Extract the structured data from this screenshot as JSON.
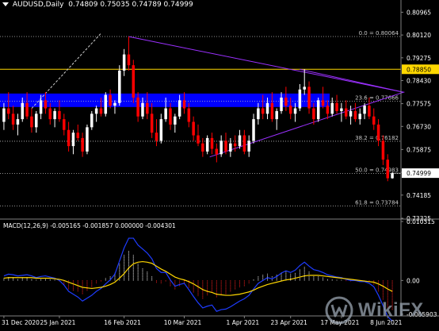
{
  "header": {
    "symbol_tf": "AUDUSD,Daily",
    "ohlc": "0.74809 0.75035 0.74789 0.74999"
  },
  "colors": {
    "background": "#000000",
    "bull": "#ffffff",
    "bear": "#ff0000",
    "fib_line": "#c0c0c0",
    "blue_zone": "#0000ff",
    "triangle": "#9b30ff",
    "resistance": "#ffd700",
    "macd_line": "#1e3cff",
    "signal_line": "#ffd700"
  },
  "chart_data": [
    {
      "type": "candlestick",
      "price_axis": [
        "0.80965",
        "0.80120",
        "0.79275",
        "0.78430",
        "0.77575",
        "0.76730",
        "0.75875",
        "0.75030",
        "0.74185",
        "0.73325"
      ],
      "ylim": [
        0.73325,
        0.81065
      ],
      "date_axis": [
        "31 Dec 2020",
        "25 Jan 2021",
        "16 Feb 2021",
        "10 Mar 2021",
        "1 Apr 2021",
        "23 Apr 2021",
        "17 May 2021",
        "8 Jun 2021"
      ],
      "fib_levels": [
        {
          "label": "0.0 = 0.80064",
          "value": 0.80064
        },
        {
          "label": "23.6 = 0.77666",
          "value": 0.77666
        },
        {
          "label": "38.2 = 0.76182",
          "value": 0.76182
        },
        {
          "label": "50.0 = 0.74983",
          "value": 0.74983
        },
        {
          "label": "61.8 = 0.73784",
          "value": 0.73784
        }
      ],
      "resistance": {
        "value": 0.7885,
        "label": "0.78850"
      },
      "last_price": {
        "value": 0.74999,
        "label": "0.74999"
      },
      "blue_zone": [
        0.7745,
        0.7795
      ],
      "candles": [
        {
          "o": 0.769,
          "h": 0.776,
          "l": 0.766,
          "c": 0.774
        },
        {
          "o": 0.774,
          "h": 0.78,
          "l": 0.77,
          "c": 0.772
        },
        {
          "o": 0.772,
          "h": 0.775,
          "l": 0.766,
          "c": 0.768
        },
        {
          "o": 0.768,
          "h": 0.772,
          "l": 0.764,
          "c": 0.77
        },
        {
          "o": 0.77,
          "h": 0.778,
          "l": 0.769,
          "c": 0.776
        },
        {
          "o": 0.776,
          "h": 0.78,
          "l": 0.77,
          "c": 0.771
        },
        {
          "o": 0.771,
          "h": 0.774,
          "l": 0.765,
          "c": 0.767
        },
        {
          "o": 0.767,
          "h": 0.773,
          "l": 0.765,
          "c": 0.772
        },
        {
          "o": 0.772,
          "h": 0.779,
          "l": 0.77,
          "c": 0.777
        },
        {
          "o": 0.777,
          "h": 0.78,
          "l": 0.772,
          "c": 0.774
        },
        {
          "o": 0.774,
          "h": 0.776,
          "l": 0.768,
          "c": 0.77
        },
        {
          "o": 0.77,
          "h": 0.774,
          "l": 0.767,
          "c": 0.773
        },
        {
          "o": 0.773,
          "h": 0.777,
          "l": 0.769,
          "c": 0.77
        },
        {
          "o": 0.77,
          "h": 0.772,
          "l": 0.764,
          "c": 0.766
        },
        {
          "o": 0.766,
          "h": 0.769,
          "l": 0.758,
          "c": 0.76
        },
        {
          "o": 0.76,
          "h": 0.766,
          "l": 0.757,
          "c": 0.765
        },
        {
          "o": 0.765,
          "h": 0.768,
          "l": 0.762,
          "c": 0.763
        },
        {
          "o": 0.763,
          "h": 0.765,
          "l": 0.756,
          "c": 0.758
        },
        {
          "o": 0.758,
          "h": 0.768,
          "l": 0.757,
          "c": 0.767
        },
        {
          "o": 0.767,
          "h": 0.773,
          "l": 0.766,
          "c": 0.772
        },
        {
          "o": 0.772,
          "h": 0.775,
          "l": 0.769,
          "c": 0.774
        },
        {
          "o": 0.774,
          "h": 0.778,
          "l": 0.771,
          "c": 0.772
        },
        {
          "o": 0.772,
          "h": 0.78,
          "l": 0.771,
          "c": 0.779
        },
        {
          "o": 0.779,
          "h": 0.781,
          "l": 0.774,
          "c": 0.775
        },
        {
          "o": 0.775,
          "h": 0.777,
          "l": 0.772,
          "c": 0.776
        },
        {
          "o": 0.776,
          "h": 0.79,
          "l": 0.775,
          "c": 0.788
        },
        {
          "o": 0.788,
          "h": 0.796,
          "l": 0.786,
          "c": 0.794
        },
        {
          "o": 0.794,
          "h": 0.8006,
          "l": 0.788,
          "c": 0.79
        },
        {
          "o": 0.79,
          "h": 0.792,
          "l": 0.776,
          "c": 0.778
        },
        {
          "o": 0.778,
          "h": 0.78,
          "l": 0.769,
          "c": 0.771
        },
        {
          "o": 0.771,
          "h": 0.778,
          "l": 0.77,
          "c": 0.776
        },
        {
          "o": 0.776,
          "h": 0.78,
          "l": 0.77,
          "c": 0.772
        },
        {
          "o": 0.772,
          "h": 0.776,
          "l": 0.763,
          "c": 0.765
        },
        {
          "o": 0.765,
          "h": 0.77,
          "l": 0.76,
          "c": 0.762
        },
        {
          "o": 0.762,
          "h": 0.772,
          "l": 0.761,
          "c": 0.77
        },
        {
          "o": 0.77,
          "h": 0.778,
          "l": 0.769,
          "c": 0.774
        },
        {
          "o": 0.774,
          "h": 0.776,
          "l": 0.766,
          "c": 0.768
        },
        {
          "o": 0.768,
          "h": 0.772,
          "l": 0.765,
          "c": 0.771
        },
        {
          "o": 0.771,
          "h": 0.779,
          "l": 0.77,
          "c": 0.777
        },
        {
          "o": 0.777,
          "h": 0.78,
          "l": 0.772,
          "c": 0.774
        },
        {
          "o": 0.774,
          "h": 0.776,
          "l": 0.767,
          "c": 0.769
        },
        {
          "o": 0.769,
          "h": 0.771,
          "l": 0.762,
          "c": 0.764
        },
        {
          "o": 0.764,
          "h": 0.768,
          "l": 0.76,
          "c": 0.761
        },
        {
          "o": 0.761,
          "h": 0.763,
          "l": 0.756,
          "c": 0.758
        },
        {
          "o": 0.758,
          "h": 0.764,
          "l": 0.757,
          "c": 0.763
        },
        {
          "o": 0.763,
          "h": 0.765,
          "l": 0.757,
          "c": 0.759
        },
        {
          "o": 0.759,
          "h": 0.761,
          "l": 0.754,
          "c": 0.757
        },
        {
          "o": 0.757,
          "h": 0.764,
          "l": 0.756,
          "c": 0.762
        },
        {
          "o": 0.762,
          "h": 0.765,
          "l": 0.757,
          "c": 0.758
        },
        {
          "o": 0.758,
          "h": 0.763,
          "l": 0.756,
          "c": 0.761
        },
        {
          "o": 0.761,
          "h": 0.764,
          "l": 0.758,
          "c": 0.76
        },
        {
          "o": 0.76,
          "h": 0.766,
          "l": 0.759,
          "c": 0.764
        },
        {
          "o": 0.764,
          "h": 0.766,
          "l": 0.757,
          "c": 0.758
        },
        {
          "o": 0.758,
          "h": 0.764,
          "l": 0.756,
          "c": 0.762
        },
        {
          "o": 0.762,
          "h": 0.772,
          "l": 0.761,
          "c": 0.77
        },
        {
          "o": 0.77,
          "h": 0.776,
          "l": 0.768,
          "c": 0.774
        },
        {
          "o": 0.774,
          "h": 0.779,
          "l": 0.77,
          "c": 0.772
        },
        {
          "o": 0.772,
          "h": 0.778,
          "l": 0.77,
          "c": 0.776
        },
        {
          "o": 0.776,
          "h": 0.78,
          "l": 0.769,
          "c": 0.77
        },
        {
          "o": 0.77,
          "h": 0.774,
          "l": 0.766,
          "c": 0.773
        },
        {
          "o": 0.773,
          "h": 0.78,
          "l": 0.772,
          "c": 0.778
        },
        {
          "o": 0.778,
          "h": 0.782,
          "l": 0.773,
          "c": 0.775
        },
        {
          "o": 0.775,
          "h": 0.778,
          "l": 0.77,
          "c": 0.772
        },
        {
          "o": 0.772,
          "h": 0.776,
          "l": 0.769,
          "c": 0.774
        },
        {
          "o": 0.774,
          "h": 0.783,
          "l": 0.773,
          "c": 0.781
        },
        {
          "o": 0.781,
          "h": 0.7885,
          "l": 0.779,
          "c": 0.782
        },
        {
          "o": 0.782,
          "h": 0.784,
          "l": 0.772,
          "c": 0.774
        },
        {
          "o": 0.774,
          "h": 0.776,
          "l": 0.768,
          "c": 0.77
        },
        {
          "o": 0.77,
          "h": 0.778,
          "l": 0.769,
          "c": 0.777
        },
        {
          "o": 0.777,
          "h": 0.782,
          "l": 0.774,
          "c": 0.775
        },
        {
          "o": 0.775,
          "h": 0.777,
          "l": 0.77,
          "c": 0.772
        },
        {
          "o": 0.772,
          "h": 0.778,
          "l": 0.771,
          "c": 0.776
        },
        {
          "o": 0.776,
          "h": 0.779,
          "l": 0.772,
          "c": 0.773
        },
        {
          "o": 0.773,
          "h": 0.776,
          "l": 0.769,
          "c": 0.774
        },
        {
          "o": 0.774,
          "h": 0.777,
          "l": 0.77,
          "c": 0.771
        },
        {
          "o": 0.771,
          "h": 0.775,
          "l": 0.768,
          "c": 0.773
        },
        {
          "o": 0.773,
          "h": 0.776,
          "l": 0.769,
          "c": 0.77
        },
        {
          "o": 0.77,
          "h": 0.774,
          "l": 0.768,
          "c": 0.772
        },
        {
          "o": 0.772,
          "h": 0.776,
          "l": 0.77,
          "c": 0.775
        },
        {
          "o": 0.775,
          "h": 0.778,
          "l": 0.77,
          "c": 0.771
        },
        {
          "o": 0.771,
          "h": 0.774,
          "l": 0.766,
          "c": 0.768
        },
        {
          "o": 0.768,
          "h": 0.77,
          "l": 0.76,
          "c": 0.762
        },
        {
          "o": 0.762,
          "h": 0.764,
          "l": 0.753,
          "c": 0.755
        },
        {
          "o": 0.755,
          "h": 0.757,
          "l": 0.747,
          "c": 0.7481
        },
        {
          "o": 0.7481,
          "h": 0.7504,
          "l": 0.7479,
          "c": 0.75
        }
      ]
    },
    {
      "type": "macd",
      "label": "MACD(12,26,9) -0.005165 -0.001857 0.000000 -0.004301",
      "axis": [
        "0.010315",
        "0.00",
        "-0.005903"
      ],
      "ylim": [
        -0.0062,
        0.0106
      ],
      "histogram": [
        0.0004,
        0.0006,
        0.0005,
        0.0003,
        0.0004,
        0.0005,
        0.0003,
        0.0001,
        0.0003,
        0.0004,
        0.0002,
        0.0001,
        -0.0002,
        -0.0008,
        -0.0016,
        -0.0018,
        -0.002,
        -0.0024,
        -0.0018,
        -0.0012,
        -0.0006,
        -0.0002,
        0.0004,
        0.0008,
        0.0014,
        0.003,
        0.0045,
        0.0052,
        0.0045,
        0.003,
        0.0022,
        0.0016,
        0.0008,
        -0.0004,
        -0.0006,
        -0.0002,
        -0.001,
        -0.0016,
        -0.001,
        -0.0006,
        -0.0014,
        -0.0022,
        -0.0028,
        -0.0032,
        -0.0026,
        -0.0022,
        -0.003,
        -0.0026,
        -0.0024,
        -0.002,
        -0.0016,
        -0.0012,
        -0.001,
        -0.0006,
        0.0002,
        0.0008,
        0.001,
        0.0012,
        0.0008,
        0.001,
        0.0014,
        0.0016,
        0.0012,
        0.0014,
        0.002,
        0.0024,
        0.0016,
        0.001,
        0.0008,
        0.0006,
        0.0003,
        0.0002,
        0.0001,
        0.0001,
        -0.0001,
        -0.0002,
        -0.0001,
        -0.0002,
        -0.0001,
        -0.0003,
        -0.0008,
        -0.002,
        -0.0034,
        -0.0048,
        -0.0052
      ],
      "signal": [
        0.0004,
        0.0005,
        0.0005,
        0.0005,
        0.0005,
        0.0005,
        0.0005,
        0.0004,
        0.0004,
        0.0004,
        0.0004,
        0.0003,
        0.0002,
        0.0,
        -0.0003,
        -0.0006,
        -0.0009,
        -0.0012,
        -0.0013,
        -0.0014,
        -0.0013,
        -0.0012,
        -0.001,
        -0.0007,
        -0.0003,
        0.0004,
        0.0012,
        0.0022,
        0.0029,
        0.0032,
        0.0033,
        0.0032,
        0.003,
        0.0025,
        0.002,
        0.0016,
        0.0011,
        0.0006,
        0.0003,
        0.0001,
        -0.0002,
        -0.0006,
        -0.0011,
        -0.0016,
        -0.0019,
        -0.0021,
        -0.0024,
        -0.0025,
        -0.0026,
        -0.0026,
        -0.0025,
        -0.0024,
        -0.0022,
        -0.002,
        -0.0017,
        -0.0013,
        -0.001,
        -0.0007,
        -0.0005,
        -0.0003,
        -0.0001,
        0.0001,
        0.0002,
        0.0004,
        0.0006,
        0.0008,
        0.0009,
        0.0009,
        0.0009,
        0.0008,
        0.0007,
        0.0006,
        0.0005,
        0.0004,
        0.0003,
        0.0002,
        0.0001,
        0.0,
        -0.0001,
        -0.0002,
        -0.0003,
        -0.0006,
        -0.001,
        -0.0015,
        -0.0019
      ],
      "macd": [
        0.0008,
        0.0011,
        0.001,
        0.0008,
        0.0009,
        0.001,
        0.0008,
        0.0005,
        0.0007,
        0.0008,
        0.0006,
        0.0004,
        0.0,
        -0.0008,
        -0.0019,
        -0.0024,
        -0.0029,
        -0.0036,
        -0.0031,
        -0.0026,
        -0.0019,
        -0.0014,
        -0.0006,
        0.0001,
        0.0011,
        0.0034,
        0.0057,
        0.0074,
        0.0074,
        0.0062,
        0.0055,
        0.0048,
        0.0038,
        0.0021,
        0.0014,
        0.0014,
        0.0001,
        -0.001,
        -0.0007,
        -0.0005,
        -0.0016,
        -0.0028,
        -0.0039,
        -0.0048,
        -0.0045,
        -0.0043,
        -0.0054,
        -0.0051,
        -0.005,
        -0.0046,
        -0.0041,
        -0.0036,
        -0.0032,
        -0.0026,
        -0.0015,
        -0.0005,
        0.0,
        0.0005,
        0.0003,
        0.0007,
        0.0013,
        0.0017,
        0.0014,
        0.0018,
        0.0026,
        0.0032,
        0.0025,
        0.0019,
        0.0017,
        0.0014,
        0.001,
        0.0008,
        0.0006,
        0.0005,
        0.0002,
        0.0,
        0.0,
        -0.0002,
        -0.0002,
        -0.0005,
        -0.0011,
        -0.0026,
        -0.0044,
        -0.0063,
        -0.0071
      ]
    }
  ],
  "watermark": {
    "text": "WikiFX"
  }
}
